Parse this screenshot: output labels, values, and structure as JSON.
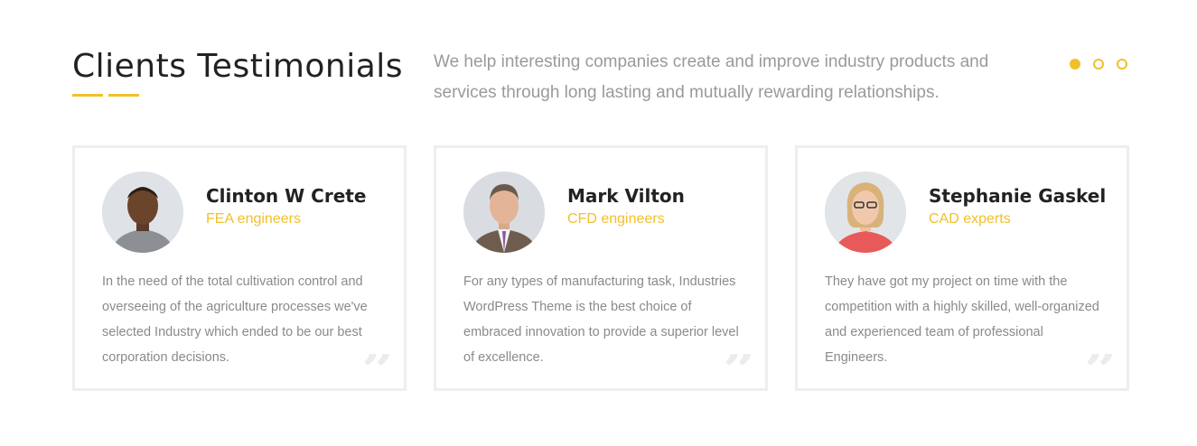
{
  "section": {
    "title": "Clients Testimonials",
    "intro": "We help interesting companies create and improve industry products and services through long lasting and mutually rewarding relationships.",
    "accent_color": "#f2c02a",
    "carousel": {
      "dots": 3,
      "active_index": 0
    }
  },
  "testimonials": [
    {
      "name": "Clinton W Crete",
      "role": "FEA engineers",
      "quote": "In the need of the total cultivation control and overseeing of the agriculture processes we've selected Industry which ended to be our best corporation decisions."
    },
    {
      "name": "Mark Vilton",
      "role": "CFD engineers",
      "quote": "For any types of manufacturing task, Industries WordPress Theme is the best choice of embraced innovation to provide a superior level of excellence."
    },
    {
      "name": "Stephanie Gaskel",
      "role": "CAD experts",
      "quote": "They have got my project on time with the competition with a highly skilled, well-organized and experienced team of professional Engineers."
    }
  ],
  "quote_icon": "closing-quote-icon"
}
